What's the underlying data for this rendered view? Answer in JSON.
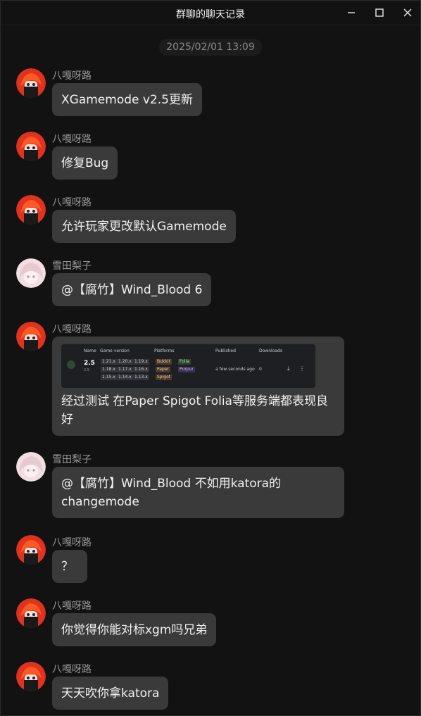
{
  "window": {
    "title": "群聊的聊天记录",
    "min_icon": "minimize-icon",
    "max_icon": "maximize-icon",
    "close_icon": "close-icon"
  },
  "timestamp": "2025/02/01 13:09",
  "messages": [
    {
      "sender": "八嘎呀路",
      "avatar": "red-hair-avatar",
      "text": "XGamemode v2.5更新"
    },
    {
      "sender": "八嘎呀路",
      "avatar": "red-hair-avatar",
      "text": "修复Bug"
    },
    {
      "sender": "八嘎呀路",
      "avatar": "red-hair-avatar",
      "text": "允许玩家更改默认Gamemode"
    },
    {
      "sender": "雪田梨子",
      "avatar": "pink-anime-avatar",
      "text": "@【腐竹】Wind_Blood 6"
    },
    {
      "sender": "八嘎呀路",
      "avatar": "red-hair-avatar",
      "text": "经过测试 在Paper Spigot Folia等服务端都表现良好",
      "screenshot": {
        "headers": [
          "Name",
          "Game version",
          "Platforms",
          "Published",
          "Downloads"
        ],
        "version": "2.5",
        "version_sub": "2.5",
        "game_versions": [
          "1.21.x",
          "1.20.x",
          "1.19.x",
          "1.18.x",
          "1.17.x",
          "1.16.x",
          "1.15.x",
          "1.14.x",
          "1.13.x"
        ],
        "platforms": [
          "Bukkit",
          "Folia",
          "Paper",
          "Purpur",
          "Spigot"
        ],
        "published": "a few seconds ago",
        "downloads": "0"
      }
    },
    {
      "sender": "雪田梨子",
      "avatar": "pink-anime-avatar",
      "text": "@【腐竹】Wind_Blood 不如用katora的changemode"
    },
    {
      "sender": "八嘎呀路",
      "avatar": "red-hair-avatar",
      "text": "？"
    },
    {
      "sender": "八嘎呀路",
      "avatar": "red-hair-avatar",
      "text": "你觉得你能对标xgm吗兄弟"
    },
    {
      "sender": "八嘎呀路",
      "avatar": "red-hair-avatar",
      "text": "天天吹你拿katora"
    }
  ]
}
